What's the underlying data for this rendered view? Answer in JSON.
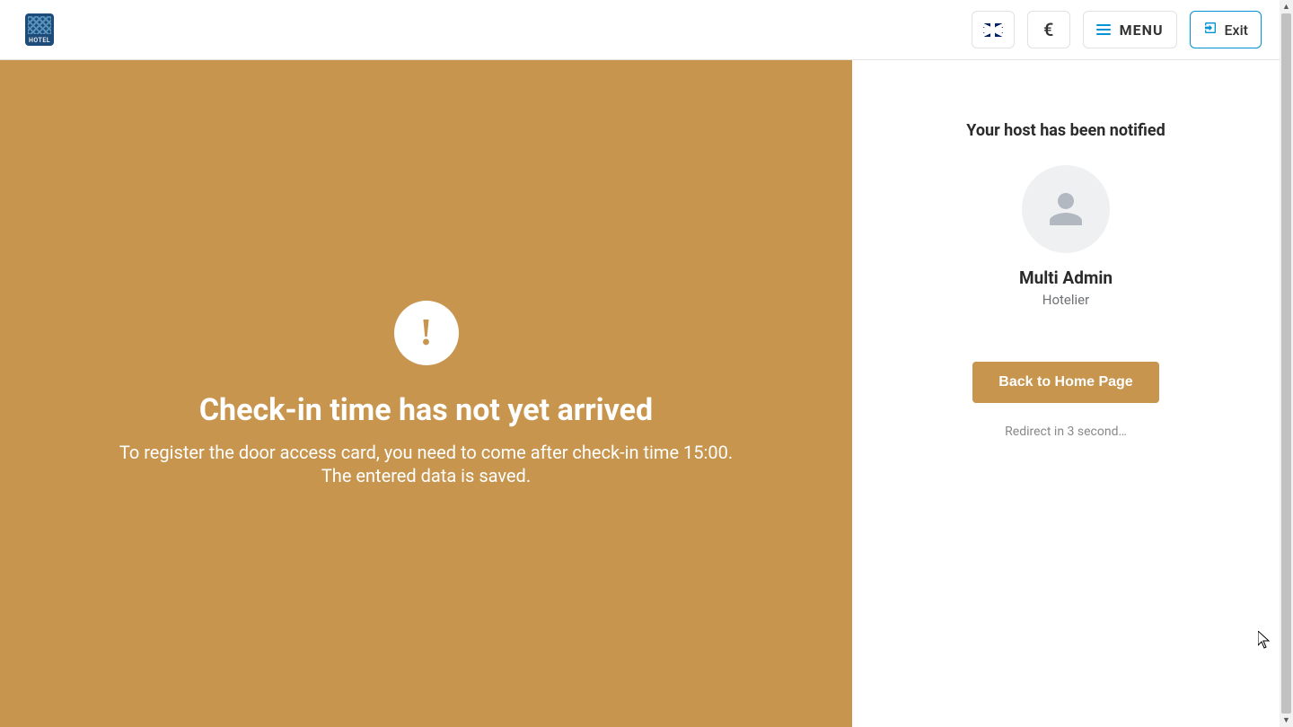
{
  "header": {
    "logo_text": "HOTEL",
    "currency_symbol": "€",
    "menu_label": "MENU",
    "exit_label": "Exit"
  },
  "left": {
    "alert_glyph": "!",
    "title": "Check-in time has not yet arrived",
    "subtitle_line1": "To register the door access card, you need to come after check-in time 15:00.",
    "subtitle_line2": "The entered data is saved."
  },
  "right": {
    "notify_title": "Your host has been notified",
    "host_name": "Multi Admin",
    "host_role": "Hotelier",
    "home_button": "Back to Home Page",
    "redirect_text": "Redirect in 3 second…"
  },
  "colors": {
    "accent": "#c7954e",
    "link_blue": "#0092d4"
  }
}
